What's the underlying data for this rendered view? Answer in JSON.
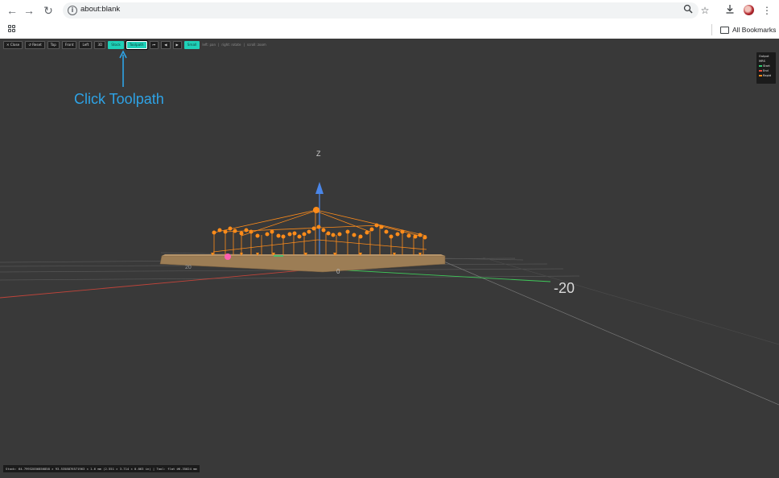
{
  "browser": {
    "url": "about:blank",
    "bookmarks_label": "All Bookmarks"
  },
  "toolbar": {
    "buttons": [
      "✕ Close",
      "↺ Reset",
      "Top",
      "Front",
      "Left",
      "3D",
      "Stock",
      "Toolpath",
      "⏮",
      "◀",
      "▶",
      "Small"
    ],
    "hints": [
      "left: pan",
      "right: rotate",
      "scroll: zoom"
    ]
  },
  "legend": {
    "items": [
      {
        "label": "Output",
        "color": "#ffffff"
      },
      {
        "label": "MRS",
        "color": "#ffffff"
      },
      {
        "label": "Start",
        "color": "#2ecc71"
      },
      {
        "label": "End",
        "color": "#e74c3c"
      },
      {
        "label": "Rapid",
        "color": "#ff8c1a"
      }
    ]
  },
  "scene": {
    "axis_z_label": "Z",
    "grid_labels": [
      "-20",
      "0",
      "20"
    ]
  },
  "status": {
    "text": "Stock: 64.79932856856858 × 93.5358876571963 × 1.6 mm (2.551 × 3.714 × 0.063 in) | Tool: flat ⌀6.35024 mm"
  },
  "annotation": {
    "text": "Click Toolpath"
  },
  "colors": {
    "viewport_bg": "#393939",
    "accent": "#1fd1b8",
    "toolpath": "#ff8c1a",
    "stock": "#9c7d55",
    "annotation": "#2ea3e6"
  }
}
